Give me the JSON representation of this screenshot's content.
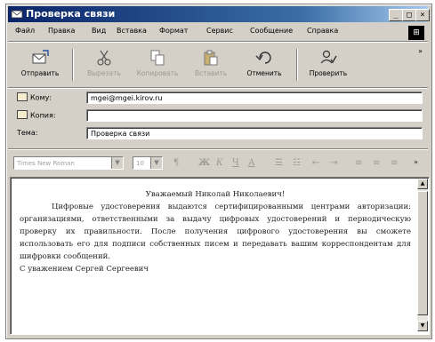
{
  "window": {
    "title": "Проверка связи",
    "controls": {
      "minimize": "_",
      "maximize": "□",
      "close": "×"
    }
  },
  "menu": [
    "Файл",
    "Правка",
    "Вид",
    "Вставка",
    "Формат",
    "Сервис",
    "Сообщение",
    "Справка"
  ],
  "toolbar": {
    "send": "Отправить",
    "cut": "Вырезать",
    "copy": "Копировать",
    "paste": "Вставить",
    "undo": "Отменить",
    "check": "Проверить"
  },
  "fields": {
    "to_label": "Кому:",
    "to_value": "mgei@mgei.kirov.ru",
    "cc_label": "Копия:",
    "cc_value": "",
    "subject_label": "Тема:",
    "subject_value": "Проверка связи"
  },
  "format_bar": {
    "font": "Times New Roman",
    "size": "10"
  },
  "message": {
    "greeting": "Уважаемый Николай Николаевич!",
    "paragraph": "Цифровые удостоверения выдаются сертифицированными центрами авторизации: организациями, ответственными за выдачу цифровых удостоверений и периодическую проверку их правильности. После получения цифрового удостоверения вы сможете использовать его для подписи собственных писем и передавать вашим корреспондентам для шифровки сообщений.",
    "signature": "С уважением Сергей Сергеевич"
  },
  "colors": {
    "titlebar_start": "#0a246a",
    "titlebar_end": "#a6caf0",
    "window_bg": "#d4d0c8"
  }
}
